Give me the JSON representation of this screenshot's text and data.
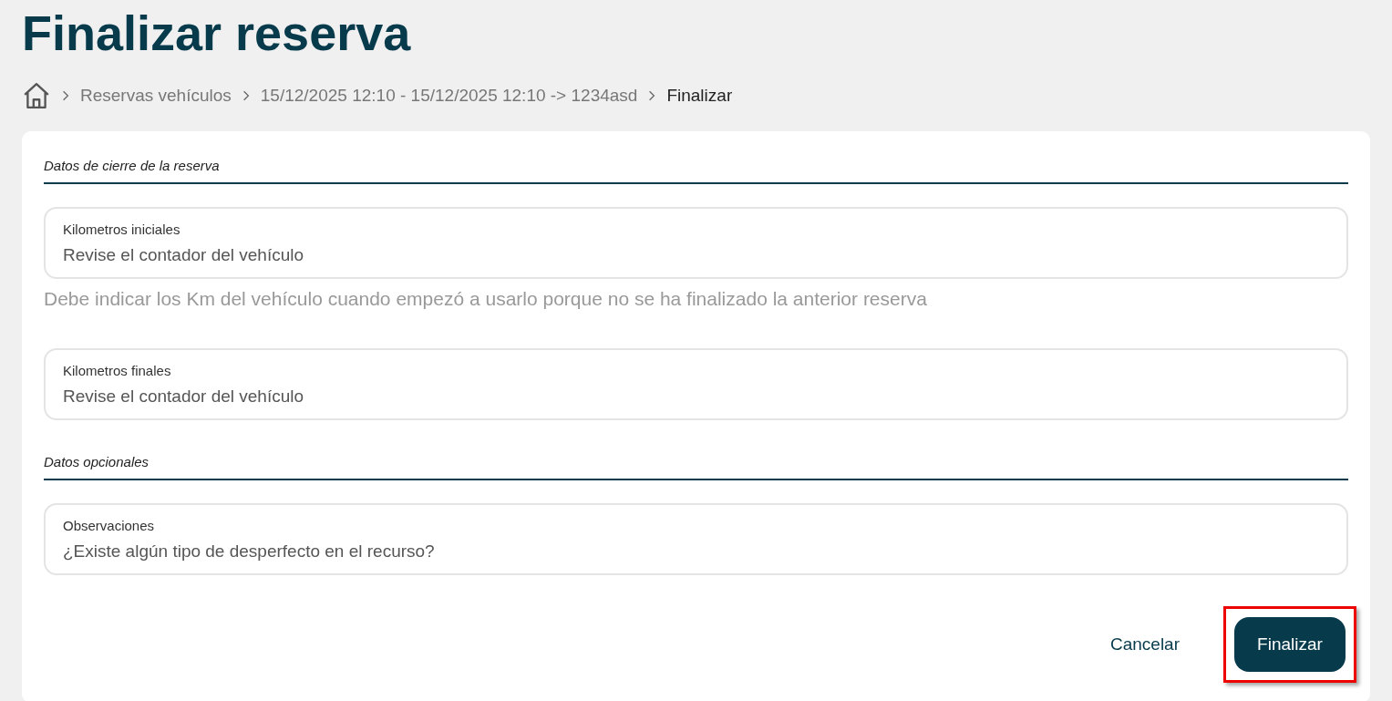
{
  "page_title": "Finalizar reserva",
  "breadcrumb": [
    {
      "label": "Reservas vehículos",
      "current": false
    },
    {
      "label": "15/12/2025 12:10 - 15/12/2025 12:10 -> 1234asd",
      "current": false
    },
    {
      "label": "Finalizar",
      "current": true
    }
  ],
  "sections": [
    {
      "heading": "Datos de cierre de la reserva",
      "fields": [
        {
          "label": "Kilometros iniciales",
          "placeholder": "Revise el contador del vehículo",
          "helper": "Debe indicar los Km del vehículo cuando empezó a usarlo porque no se ha finalizado la anterior reserva"
        },
        {
          "label": "Kilometros finales",
          "placeholder": "Revise el contador del vehículo"
        }
      ]
    },
    {
      "heading": "Datos opcionales",
      "fields": [
        {
          "label": "Observaciones",
          "placeholder": "¿Existe algún tipo de desperfecto en el recurso?"
        }
      ]
    }
  ],
  "buttons": [
    {
      "kind": "link",
      "label": "Cancelar",
      "highlighted": false
    },
    {
      "kind": "primary",
      "label": "Finalizar",
      "highlighted": true
    }
  ]
}
